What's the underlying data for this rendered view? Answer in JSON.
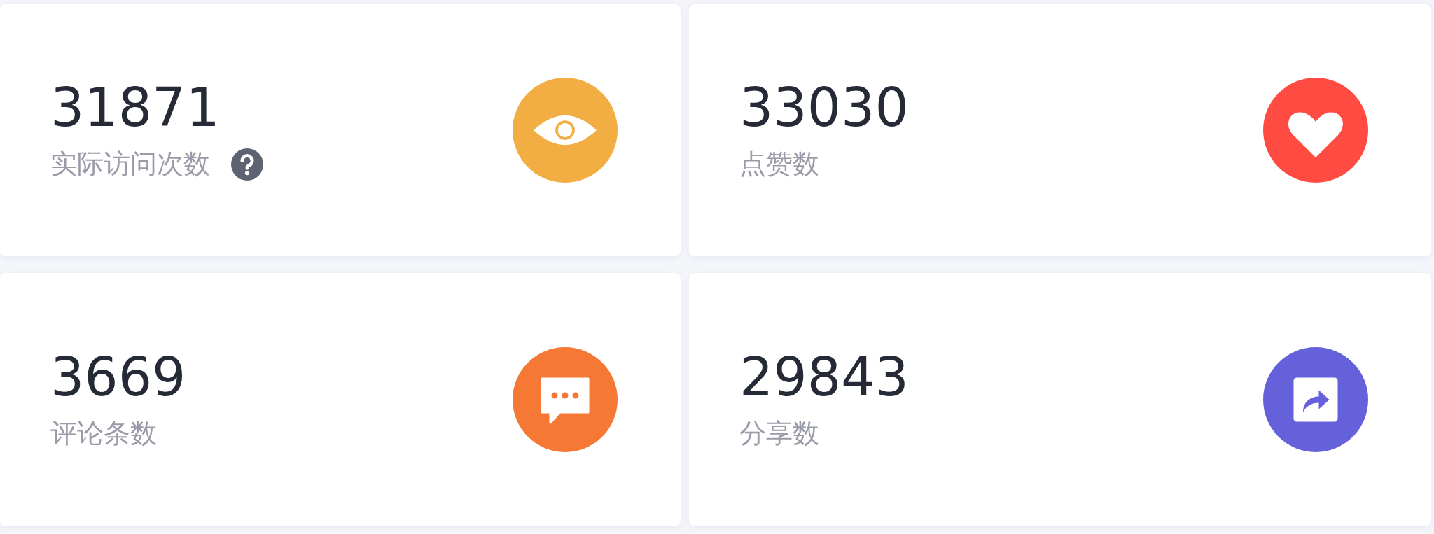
{
  "cards": [
    {
      "value": "31871",
      "label": "实际访问次数",
      "help": true,
      "kind": "eye",
      "color": "#f2ae42"
    },
    {
      "value": "33030",
      "label": "点赞数",
      "help": false,
      "kind": "heart",
      "color": "#ff4b42"
    },
    {
      "value": "3669",
      "label": "评论条数",
      "help": false,
      "kind": "comment",
      "color": "#f57834"
    },
    {
      "value": "29843",
      "label": "分享数",
      "help": false,
      "kind": "share",
      "color": "#6561db"
    }
  ]
}
